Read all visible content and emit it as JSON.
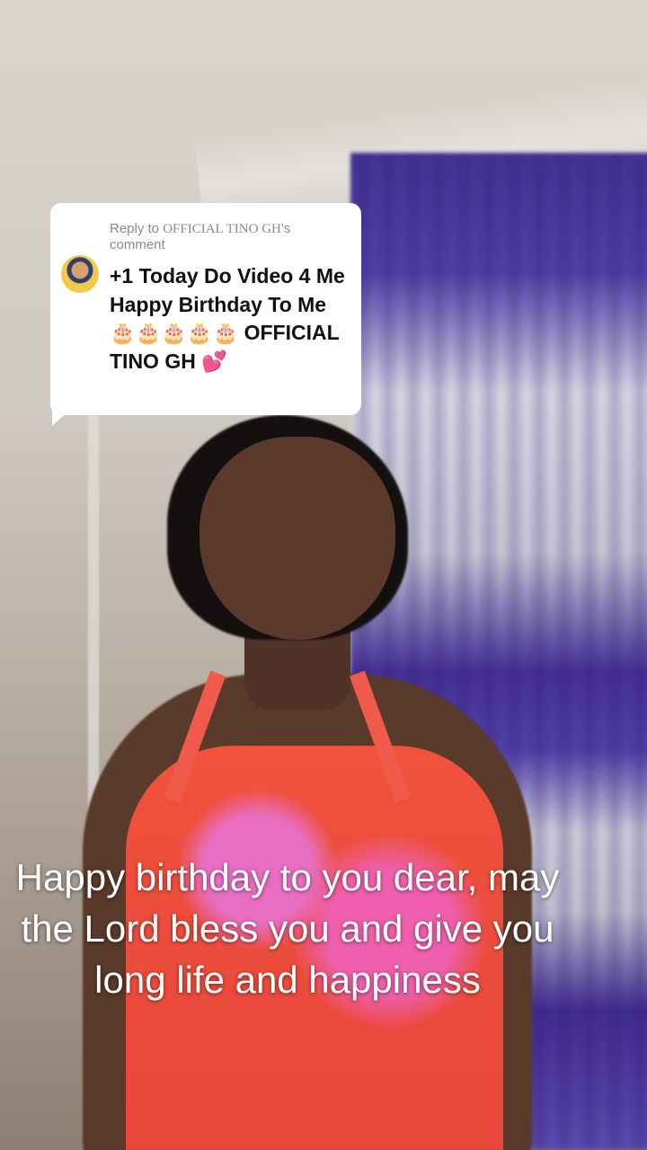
{
  "reply": {
    "prefix": "Reply to ",
    "name": "OFFICIAL TINO GH",
    "suffix": "'s comment",
    "comment_text": "+1 Today Do Video 4 Me Happy Birthday To Me 🎂🎂🎂🎂🎂 OFFICIAL TINO GH 💕",
    "avatar_icon": "user-avatar"
  },
  "caption": "Happy birthday to you dear, may the Lord bless you and give you long life and happiness",
  "colors": {
    "card_bg": "#ffffff",
    "caption_text": "#ffffff",
    "meta_text": "#8a8a8a"
  }
}
